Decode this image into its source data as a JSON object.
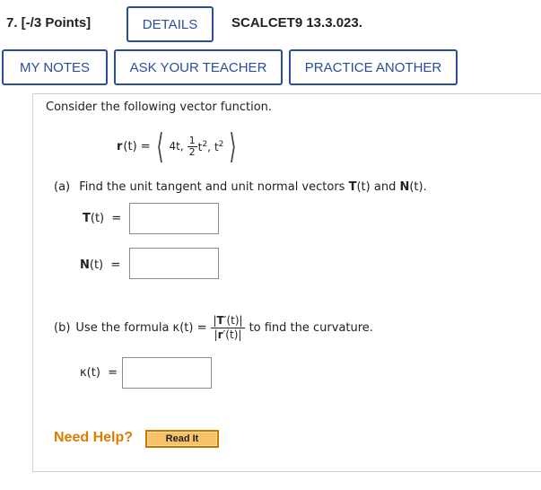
{
  "header": {
    "question_number": "7. [-/3 Points]",
    "details_label": "DETAILS",
    "question_id": "SCALCET9 13.3.023."
  },
  "toolbar": {
    "my_notes_label": "MY NOTES",
    "ask_teacher_label": "ASK YOUR TEACHER",
    "practice_another_label": "PRACTICE ANOTHER"
  },
  "problem": {
    "prompt": "Consider the following vector function.",
    "vector_lhs": "r",
    "vector_arg": "(t) =",
    "comp1": "4t,",
    "comp2_num": "1",
    "comp2_den": "2",
    "comp2_var": "t",
    "comp2_exp": "2",
    "comp2_sep": ",",
    "comp3_var": "t",
    "comp3_exp": "2",
    "angle_open": "⟨",
    "angle_close": "⟩"
  },
  "part_a": {
    "tag": "(a)",
    "text_pre": "Find the unit tangent and unit normal vectors",
    "T_sym": "T",
    "T_arg": "(t)",
    "and": "and",
    "N_sym": "N",
    "N_arg": "(t).",
    "T_label_sym": "T",
    "T_label_rest": "(t)  =",
    "N_label_sym": "N",
    "N_label_rest": "(t)  =",
    "T_answer": "",
    "N_answer": ""
  },
  "part_b": {
    "tag": "(b)",
    "text_pre": "Use the formula κ(t) =",
    "frac_num_pre": "|",
    "frac_num_sym": "T",
    "frac_num_post": "′(t)|",
    "frac_den_pre": "|",
    "frac_den_sym": "r",
    "frac_den_post": "′(t)|",
    "text_post": "to find the curvature.",
    "K_label": "κ(t)  =",
    "K_answer": ""
  },
  "help": {
    "label": "Need Help?",
    "read_it": "Read It"
  }
}
